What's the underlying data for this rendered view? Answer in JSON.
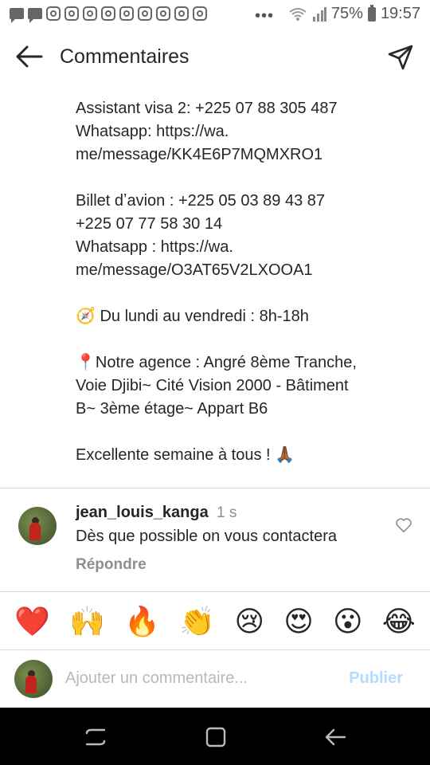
{
  "status_bar": {
    "battery": "75%",
    "time": "19:57",
    "overflow": "•••"
  },
  "header": {
    "title": "Commentaires"
  },
  "caption": {
    "lines": [
      "Assistant visa 2: +225 07 88 305 487",
      "Whatsapp: https://wa.",
      "me/message/KK4E6P7MQMXRO1",
      "",
      "Billet dʼavion : +225 05 03 89 43 87",
      "+225 07 77 58 30 14",
      "Whatsapp : https://wa.",
      "me/message/O3AT65V2LXOOA1",
      "",
      "🧭 Du lundi au vendredi : 8h-18h",
      "",
      "📍Notre agence : Angré 8ème Tranche,",
      "Voie Djibi~ Cité Vision 2000 - Bâtiment",
      "B~ 3ème étage~ Appart B6",
      "",
      "Excellente semaine à tous ! 🙏🏾"
    ]
  },
  "comment": {
    "username": "jean_louis_kanga",
    "time": "1 s",
    "text": "Dès que possible on vous contactera",
    "reply_label": "Répondre"
  },
  "emoji_bar": [
    "❤️",
    "🙌",
    "🔥",
    "👏",
    "😢",
    "😍",
    "😮",
    "😂"
  ],
  "add_comment": {
    "placeholder": "Ajouter un commentaire...",
    "publish_label": "Publier"
  },
  "colors": {
    "publish": "#b3dbff",
    "secondary_text": "#8e8e8e",
    "nav_bar": "#000000"
  }
}
